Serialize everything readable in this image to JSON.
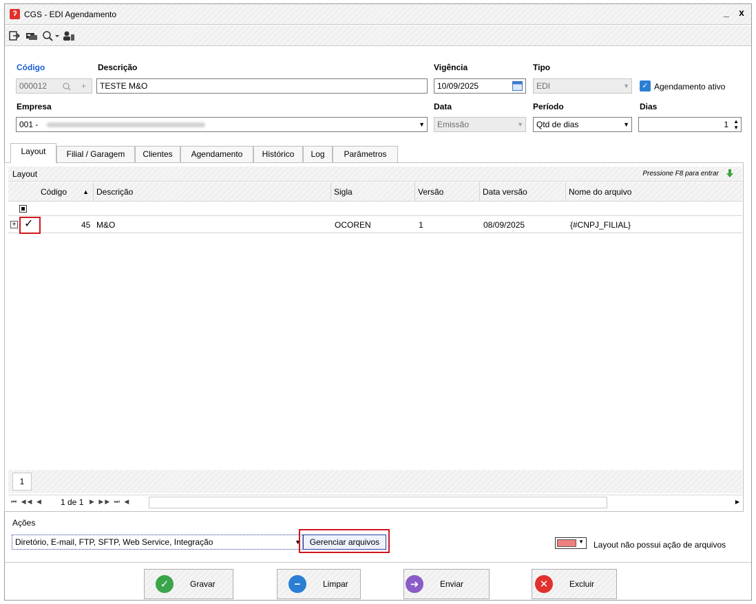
{
  "window": {
    "title": "CGS - EDI Agendamento",
    "minimize": "_",
    "close": "x"
  },
  "form": {
    "codigo_label": "Código",
    "codigo_value": "000012",
    "descricao_label": "Descrição",
    "descricao_value": "TESTE M&O",
    "vigencia_label": "Vigência",
    "vigencia_value": "10/09/2025",
    "tipo_label": "Tipo",
    "tipo_value": "EDI",
    "agendamento_ativo_label": "Agendamento ativo",
    "empresa_label": "Empresa",
    "empresa_value": "001 -",
    "data_label": "Data",
    "data_value": "Emissão",
    "periodo_label": "Período",
    "periodo_value": "Qtd de dias",
    "dias_label": "Dias",
    "dias_value": "1"
  },
  "tabs": [
    "Layout",
    "Filial / Garagem",
    "Clientes",
    "Agendamento",
    "Histórico",
    "Log",
    "Parâmetros"
  ],
  "layout_panel": {
    "group_label": "Layout",
    "hint": "Pressione F8 para entrar",
    "columns": [
      "Código",
      "Descrição",
      "Sigla",
      "Versão",
      "Data versão",
      "Nome do arquivo"
    ],
    "row": {
      "codigo": "45",
      "descricao": "M&O",
      "sigla": "OCOREN",
      "versao": "1",
      "data_versao": "08/09/2025",
      "nome_arquivo": "{#CNPJ_FILIAL}"
    },
    "page_number": "1",
    "pager_text": "1 de 1"
  },
  "acoes": {
    "label": "Ações",
    "value": "Diretório, E-mail, FTP, SFTP, Web Service, Integração",
    "manage_button": "Gerenciar arquivos",
    "legend": "Layout não possui ação de arquivos"
  },
  "buttons": {
    "gravar": "Gravar",
    "limpar": "Limpar",
    "enviar": "Enviar",
    "excluir": "Excluir"
  },
  "colors": {
    "accent_blue": "#1a5fd6",
    "highlight_red": "#d0161e",
    "legend_swatch": "#f08080"
  }
}
